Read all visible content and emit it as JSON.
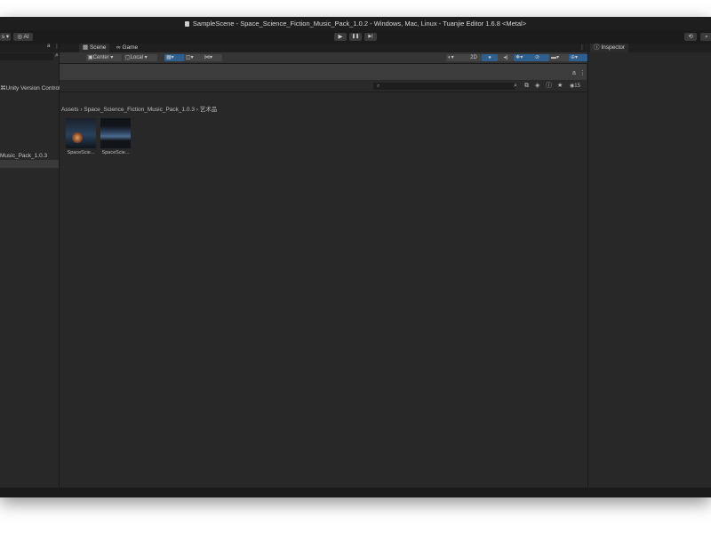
{
  "window": {
    "title": "SampleScene - Space_Science_Fiction_Music_Pack_1.0.2 - Windows, Mac, Linux - Tuanjie Editor 1.6.8 <Metal>"
  },
  "toolbar": {
    "left_partial": "s",
    "ai_label": "AI",
    "play": "▶",
    "pause": "❚❚",
    "step": "▶|",
    "history": "⟲"
  },
  "scene_tabs": [
    "Scene",
    "Game"
  ],
  "scene_toolbar": {
    "center_label": "Center",
    "local_label": "Local",
    "mode_2d": "2D"
  },
  "left_panel": {
    "vcs_label": "Unity Version Control",
    "selected_item": "Music_Pack_1.0.3"
  },
  "project": {
    "breadcrumb": [
      "Assets",
      "Space_Science_Fiction_Music_Pack_1.0.3",
      "艺术品"
    ],
    "search_placeholder": "",
    "count": "15",
    "assets": [
      {
        "label": "SpaceScie..."
      },
      {
        "label": "SpaceScie..."
      }
    ]
  },
  "inspector": {
    "tab_label": "Inspector"
  },
  "colors": {
    "panel_bg": "#282828",
    "accent_blue": "#2f5f8f"
  }
}
